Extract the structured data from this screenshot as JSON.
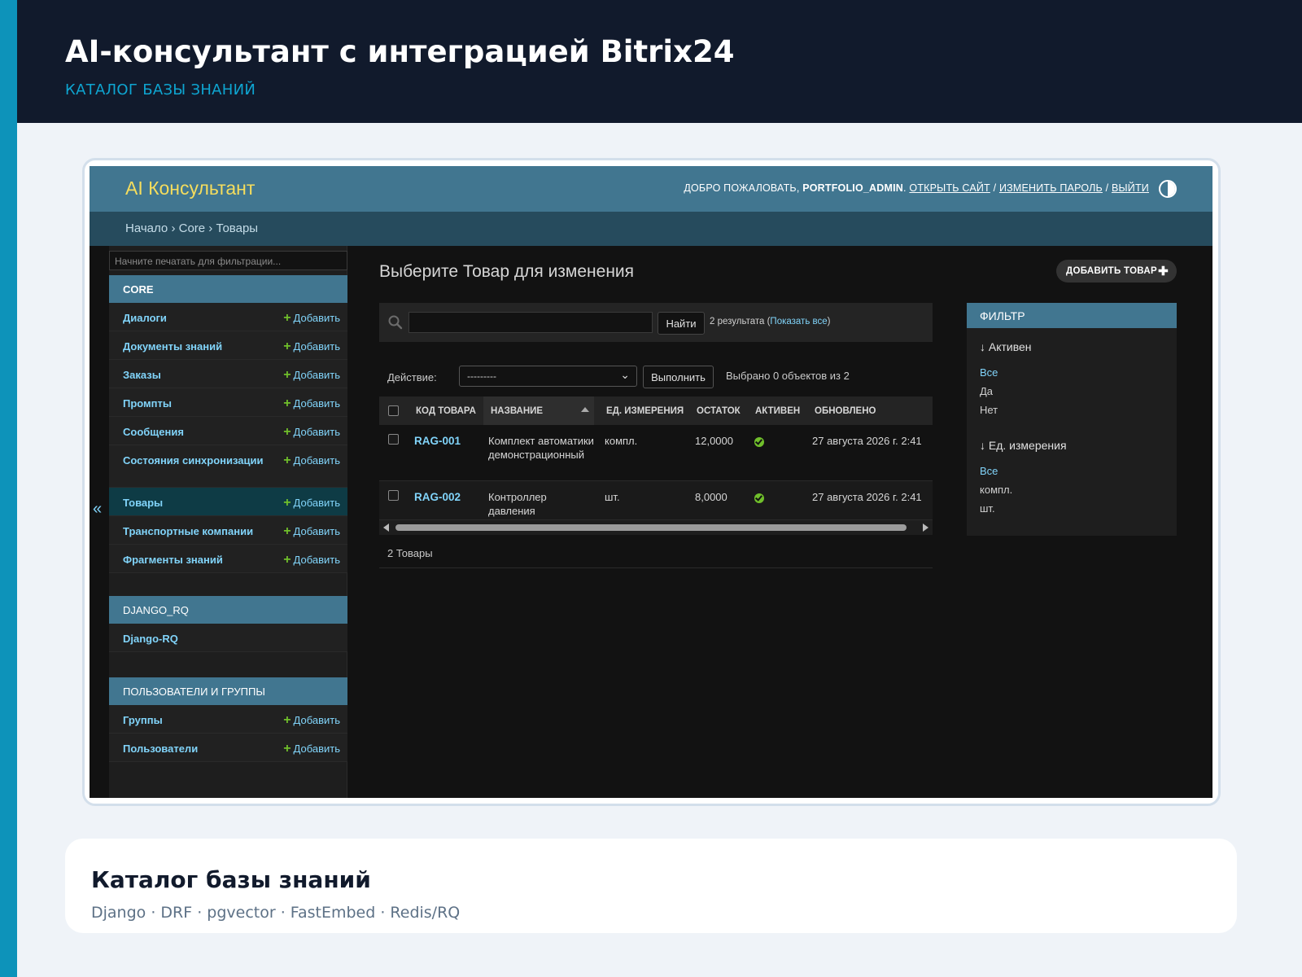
{
  "slide": {
    "title": "AI-консультант с интеграцией Bitrix24",
    "subtitle": "КАТАЛОГ БАЗЫ ЗНАНИЙ",
    "caption_title": "Каталог базы знаний",
    "caption_stack": "Django · DRF · pgvector · FastEmbed · Redis/RQ"
  },
  "header": {
    "brand": "AI Консультант",
    "welcome": "ДОБРО ПОЖАЛОВАТЬ,",
    "username": "PORTFOLIO_ADMIN",
    "view_site": "ОТКРЫТЬ САЙТ",
    "change_password": "ИЗМЕНИТЬ ПАРОЛЬ",
    "logout": "ВЫЙТИ",
    "sep": "/"
  },
  "breadcrumbs": {
    "home": "Начало",
    "app": "Core",
    "current": "Товары",
    "sep": "›"
  },
  "sidebar": {
    "filter_placeholder": "Начните печатать для фильтрации...",
    "add_label": "Добавить",
    "collapse": "«",
    "modules": [
      {
        "caption": "CORE",
        "items": [
          {
            "label": "Диалоги",
            "add": true
          },
          {
            "label": "Документы знаний",
            "add": true
          },
          {
            "label": "Заказы",
            "add": true
          },
          {
            "label": "Промпты",
            "add": true
          },
          {
            "label": "Сообщения",
            "add": true
          },
          {
            "label": "Состояния синхронизации",
            "add": true
          },
          {
            "label": "Товары",
            "add": true,
            "current": true
          },
          {
            "label": "Транспортные компании",
            "add": true
          },
          {
            "label": "Фрагменты знаний",
            "add": true
          }
        ]
      },
      {
        "caption": "DJANGO_RQ",
        "items": [
          {
            "label": "Django-RQ",
            "add": false
          }
        ]
      },
      {
        "caption": "ПОЛЬЗОВАТЕЛИ И ГРУППЫ",
        "items": [
          {
            "label": "Группы",
            "add": true
          },
          {
            "label": "Пользователи",
            "add": true
          }
        ]
      }
    ]
  },
  "content": {
    "title": "Выберите Товар для изменения",
    "add_button": "ДОБАВИТЬ ТОВАР",
    "search": {
      "value": "",
      "button": "Найти",
      "count": "2 результата",
      "show_all": "Показать все"
    },
    "actions": {
      "label": "Действие:",
      "selected": "---------",
      "run": "Выполнить",
      "selected_count": "Выбрано 0 объектов из 2"
    },
    "table": {
      "columns": [
        "КОД ТОВАРА",
        "НАЗВАНИЕ",
        "ЕД. ИЗМЕРЕНИЯ",
        "ОСТАТОК",
        "АКТИВЕН",
        "ОБНОВЛЕНО"
      ],
      "rows": [
        {
          "code": "RAG-001",
          "name": "Комплект автоматики демонстрационный",
          "unit": "компл.",
          "stock": "12,0000",
          "active": true,
          "updated": "27 августа 2026 г. 2:41"
        },
        {
          "code": "RAG-002",
          "name": "Контроллер давления",
          "unit": "шт.",
          "stock": "8,0000",
          "active": true,
          "updated": "27 августа 2026 г. 2:41"
        }
      ]
    },
    "paginator": "2 Товары"
  },
  "filter": {
    "caption": "ФИЛЬТР",
    "groups": [
      {
        "title": "↓ Активен",
        "options": [
          {
            "label": "Все",
            "selected": true
          },
          {
            "label": "Да",
            "selected": false
          },
          {
            "label": "Нет",
            "selected": false
          }
        ]
      },
      {
        "title": "↓ Ед. измерения",
        "options": [
          {
            "label": "Все",
            "selected": true
          },
          {
            "label": "компл.",
            "selected": false
          },
          {
            "label": "шт.",
            "selected": false
          }
        ]
      }
    ]
  },
  "colors": {
    "header": "#417690",
    "breadcrumbs": "#264b5d",
    "brand": "#f5dd5d",
    "link": "#81d4fa",
    "add_plus": "#70bf2b",
    "slide_band": "#111a2c",
    "slide_accent": "#0d93ba"
  },
  "icons": {
    "search": "search-icon",
    "theme": "theme-toggle-icon",
    "add": "plus-icon",
    "active": "check-circle-icon"
  }
}
